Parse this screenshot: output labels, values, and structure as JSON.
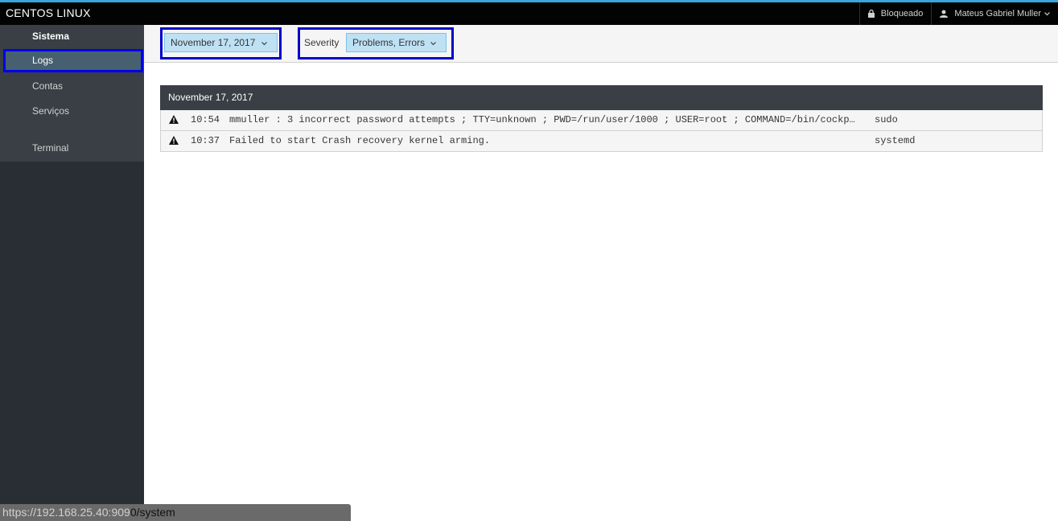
{
  "app": {
    "brand": "CENTOS LINUX"
  },
  "topbar": {
    "locked_label": "Bloqueado",
    "user_label": "Mateus Gabriel Muller"
  },
  "sidebar": {
    "items": [
      {
        "label": "Sistema"
      },
      {
        "label": "Logs"
      },
      {
        "label": "Contas"
      },
      {
        "label": "Serviços"
      },
      {
        "label": "Terminal"
      }
    ]
  },
  "filters": {
    "date_value": "November 17, 2017",
    "severity_label": "Severity",
    "severity_value": "Problems, Errors"
  },
  "log": {
    "day_header": "November 17, 2017",
    "entries": [
      {
        "time": "10:54",
        "message": "mmuller : 3 incorrect password attempts ; TTY=unknown ; PWD=/run/user/1000 ; USER=root ; COMMAND=/bin/cockp…",
        "source": "sudo"
      },
      {
        "time": "10:37",
        "message": "Failed to start Crash recovery kernel arming.",
        "source": "systemd"
      }
    ]
  },
  "statusbar": {
    "url_host": "https://192.168.25.40:909",
    "url_rest": "0/system"
  },
  "colors": {
    "accent": "#39a5dc",
    "highlight": "#0000ee",
    "active_nav": "#46606f"
  }
}
